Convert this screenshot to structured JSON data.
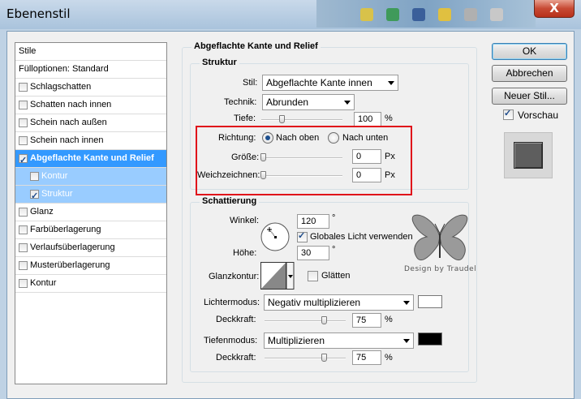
{
  "window": {
    "title": "Ebenenstil",
    "close_glyph": "X"
  },
  "style_list": {
    "header": "Stile",
    "blend_options": "Fülloptionen: Standard",
    "items": [
      {
        "label": "Schlagschatten",
        "checked": false
      },
      {
        "label": "Schatten nach innen",
        "checked": false
      },
      {
        "label": "Schein nach außen",
        "checked": false
      },
      {
        "label": "Schein nach innen",
        "checked": false
      },
      {
        "label": "Abgeflachte Kante und Relief",
        "checked": true,
        "selected": true
      },
      {
        "label": "Kontur",
        "checked": false,
        "sub": true
      },
      {
        "label": "Struktur",
        "checked": true,
        "sub": true
      },
      {
        "label": "Glanz",
        "checked": false
      },
      {
        "label": "Farbüberlagerung",
        "checked": false
      },
      {
        "label": "Verlaufsüberlagerung",
        "checked": false
      },
      {
        "label": "Musterüberlagerung",
        "checked": false
      },
      {
        "label": "Kontur",
        "checked": false
      }
    ]
  },
  "panel": {
    "title": "Abgeflachte Kante und Relief",
    "structure": {
      "title": "Struktur",
      "style_label": "Stil:",
      "style_value": "Abgeflachte Kante innen",
      "technique_label": "Technik:",
      "technique_value": "Abrunden",
      "depth_label": "Tiefe:",
      "depth_value": "100",
      "depth_unit": "%",
      "direction_label": "Richtung:",
      "direction_up": "Nach oben",
      "direction_down": "Nach unten",
      "direction_selected": "Nach oben",
      "size_label": "Größe:",
      "size_value": "0",
      "size_unit": "Px",
      "soften_label": "Weichzeichnen:",
      "soften_value": "0",
      "soften_unit": "Px"
    },
    "shading": {
      "title": "Schattierung",
      "angle_label": "Winkel:",
      "angle_value": "120",
      "angle_unit": "°",
      "global_light_label": "Globales Licht verwenden",
      "global_light_checked": true,
      "altitude_label": "Höhe:",
      "altitude_value": "30",
      "altitude_unit": "°",
      "gloss_contour_label": "Glanzkontur:",
      "antialias_label": "Glätten",
      "antialias_checked": false,
      "highlight_mode_label": "Lichtermodus:",
      "highlight_mode_value": "Negativ multiplizieren",
      "highlight_color": "#ffffff",
      "highlight_opacity_label": "Deckkraft:",
      "highlight_opacity_value": "75",
      "highlight_opacity_unit": "%",
      "shadow_mode_label": "Tiefenmodus:",
      "shadow_mode_value": "Multiplizieren",
      "shadow_color": "#000000",
      "shadow_opacity_label": "Deckkraft:",
      "shadow_opacity_value": "75",
      "shadow_opacity_unit": "%"
    }
  },
  "buttons": {
    "ok": "OK",
    "cancel": "Abbrechen",
    "new_style": "Neuer Stil...",
    "preview_label": "Vorschau",
    "preview_checked": true
  },
  "watermark": {
    "text": "Design by Traudel"
  },
  "colors": {
    "selection": "#3399ff",
    "subselection": "#99ccff",
    "highlight_box": "#e0101a"
  }
}
